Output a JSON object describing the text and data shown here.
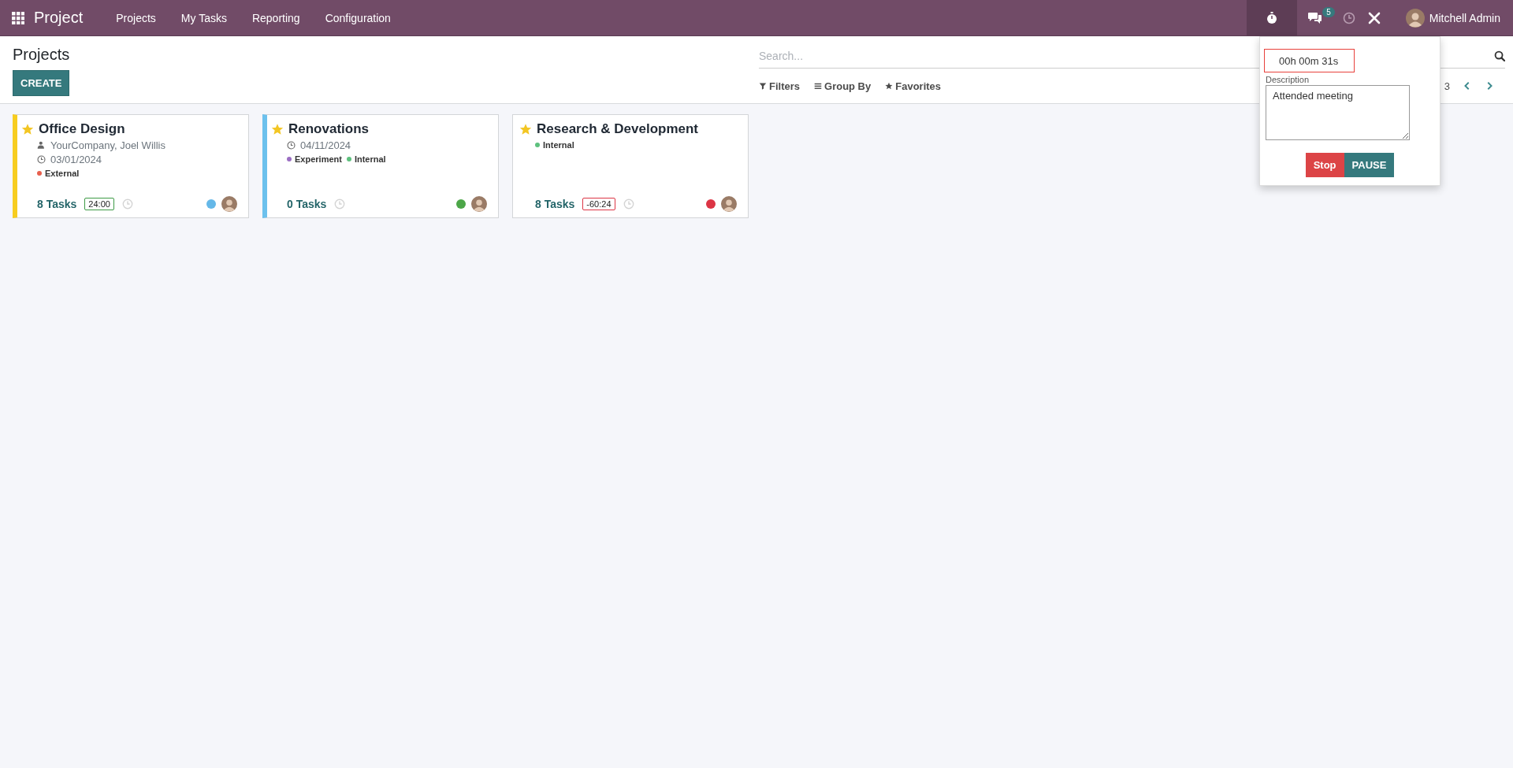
{
  "navbar": {
    "app_name": "Project",
    "menu": [
      "Projects",
      "My Tasks",
      "Reporting",
      "Configuration"
    ],
    "timer_active": true,
    "messages_badge": "5",
    "user_name": "Mitchell Admin"
  },
  "control_panel": {
    "title": "Projects",
    "create_button": "CREATE",
    "search": {
      "placeholder": "Search..."
    },
    "filters": [
      {
        "label": "Filters",
        "kind": "filter"
      },
      {
        "label": "Group By",
        "kind": "group"
      },
      {
        "label": "Favorites",
        "kind": "favorite"
      }
    ],
    "pager": "3"
  },
  "projects": [
    {
      "name": "Office Design",
      "favorite": true,
      "color": "#f7cd1f",
      "details": [
        {
          "kind": "customer",
          "text": "YourCompany, Joel Willis"
        },
        {
          "kind": "date",
          "text": "03/01/2024"
        }
      ],
      "tags": [
        {
          "label": "External",
          "color": "#e8604e"
        }
      ],
      "tasks": "8 Tasks",
      "time_badge": {
        "text": "24:00",
        "kind": "on_track"
      },
      "status": {
        "color": "#65b8e8"
      }
    },
    {
      "name": "Renovations",
      "favorite": true,
      "color": "#6cc1ed",
      "details": [
        {
          "kind": "date",
          "text": "04/11/2024"
        }
      ],
      "tags": [
        {
          "label": "Experiment",
          "color": "#9b6ec3"
        },
        {
          "label": "Internal",
          "color": "#5ec17e"
        }
      ],
      "tasks": "0 Tasks",
      "status": {
        "color": "#4ca648"
      }
    },
    {
      "name": "Research & Development",
      "favorite": true,
      "tags": [
        {
          "label": "Internal",
          "color": "#5ec17e"
        }
      ],
      "tasks": "8 Tasks",
      "time_badge": {
        "text": "-60:24",
        "kind": "overdue"
      },
      "status": {
        "color": "#dc3545"
      }
    }
  ],
  "timer_popup": {
    "time": "00h 00m 31s",
    "description_label": "Description",
    "description": "Attended meeting",
    "buttons": [
      {
        "label": "Stop",
        "kind": "danger"
      },
      {
        "label": "PAUSE",
        "kind": "primary"
      }
    ]
  }
}
